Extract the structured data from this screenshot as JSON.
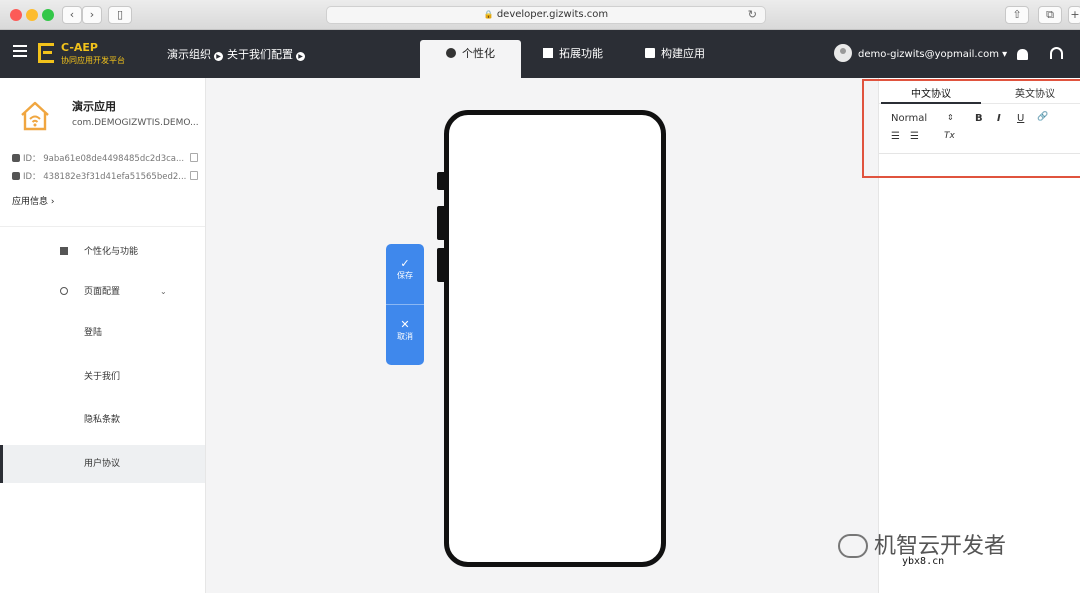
{
  "browser": {
    "url": "developer.gizwits.com"
  },
  "header": {
    "brand": "C-AEP",
    "brand_sub": "协同应用开发平台",
    "org": "演示组织",
    "config": "关于我们配置",
    "tabs": [
      {
        "label": "个性化",
        "icon": "palette-icon",
        "active": true
      },
      {
        "label": "拓展功能",
        "icon": "puzzle-icon",
        "active": false
      },
      {
        "label": "构建应用",
        "icon": "box-icon",
        "active": false
      }
    ],
    "user_email": "demo-gizwits@yopmail.com ▾"
  },
  "sidebar": {
    "app_name": "演示应用",
    "app_package": "com.DEMOGIZWTIS.DEMO...",
    "ios_id": "ID： 9aba61e08de4498485dc2d3ca...",
    "android_id": "ID： 438182e3f31d41efa51565bed2...",
    "app_info": "应用信息 ›",
    "menu": [
      {
        "label": "个性化与功能",
        "icon": "puzzle-icon"
      },
      {
        "label": "页面配置",
        "icon": "tree-icon",
        "expandable": true
      },
      {
        "label": "登陆"
      },
      {
        "label": "关于我们"
      },
      {
        "label": "隐私条款"
      },
      {
        "label": "用户协议",
        "active": true
      }
    ]
  },
  "canvas": {
    "save_label": "保存",
    "cancel_label": "取消"
  },
  "editor": {
    "tabs": [
      "中文协议",
      "英文协议"
    ],
    "format": "Normal",
    "format_arrows": "⇕",
    "bold": "B",
    "italic": "I",
    "underline": "U",
    "link": "🔗",
    "ordered_list": "☰",
    "bullet_list": "☰",
    "clear_format": "Tx"
  },
  "watermark": {
    "brand": "机智云开发者",
    "site": "ybx8.cn"
  }
}
